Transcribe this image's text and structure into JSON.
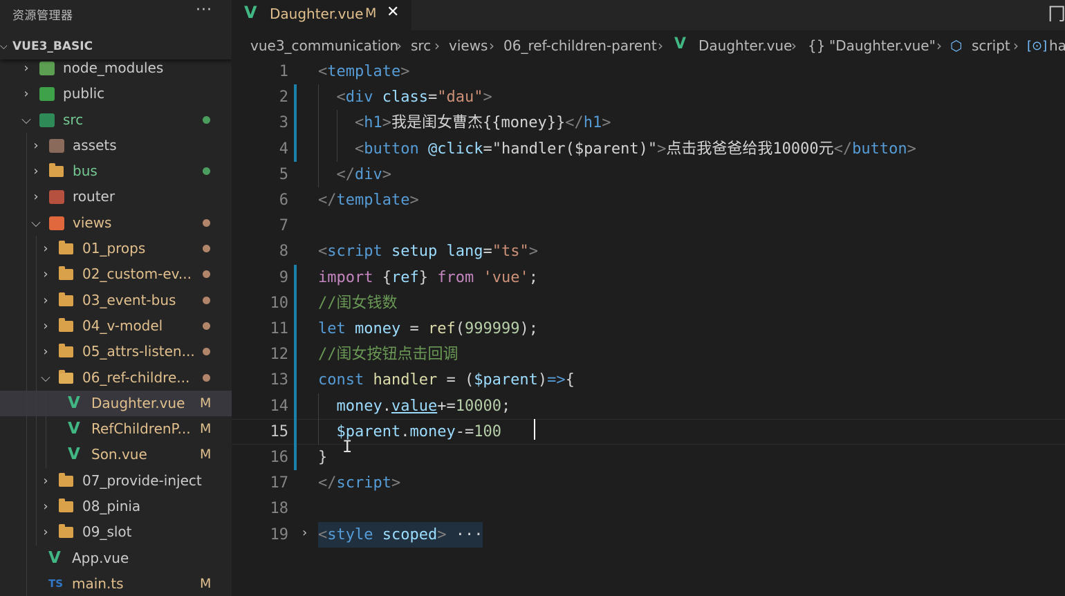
{
  "sidebar": {
    "title": "资源管理器",
    "more": "···",
    "project": "VUE3_BASIC",
    "items": [
      {
        "label": "node_modules",
        "depth": 1,
        "expanded": false,
        "icon": "node-modules-folder-icon",
        "status": ""
      },
      {
        "label": "public",
        "depth": 1,
        "expanded": false,
        "icon": "public-folder-icon",
        "status": ""
      },
      {
        "label": "src",
        "depth": 1,
        "expanded": true,
        "icon": "src-folder-icon",
        "status": "dot-green"
      },
      {
        "label": "assets",
        "depth": 2,
        "expanded": false,
        "icon": "assets-folder-icon",
        "status": ""
      },
      {
        "label": "bus",
        "depth": 2,
        "expanded": false,
        "icon": "folder-icon",
        "status": "dot-green"
      },
      {
        "label": "router",
        "depth": 2,
        "expanded": false,
        "icon": "router-folder-icon",
        "status": ""
      },
      {
        "label": "views",
        "depth": 2,
        "expanded": true,
        "icon": "views-folder-icon",
        "status": "dot-brown"
      },
      {
        "label": "01_props",
        "depth": 3,
        "expanded": false,
        "icon": "folder-icon",
        "status": "dot-brown"
      },
      {
        "label": "02_custom-ev...",
        "depth": 3,
        "expanded": false,
        "icon": "folder-icon",
        "status": "dot-brown"
      },
      {
        "label": "03_event-bus",
        "depth": 3,
        "expanded": false,
        "icon": "folder-icon",
        "status": "dot-brown"
      },
      {
        "label": "04_v-model",
        "depth": 3,
        "expanded": false,
        "icon": "folder-icon",
        "status": "dot-brown"
      },
      {
        "label": "05_attrs-listen...",
        "depth": 3,
        "expanded": false,
        "icon": "folder-icon",
        "status": "dot-brown"
      },
      {
        "label": "06_ref-childre...",
        "depth": 3,
        "expanded": true,
        "icon": "folder-open-icon",
        "status": "dot-brown"
      },
      {
        "label": "Daughter.vue",
        "depth": 4,
        "file": true,
        "icon": "vue-file-icon",
        "status": "M",
        "selected": true
      },
      {
        "label": "RefChildrenP...",
        "depth": 4,
        "file": true,
        "icon": "vue-file-icon",
        "status": "M"
      },
      {
        "label": "Son.vue",
        "depth": 4,
        "file": true,
        "icon": "vue-file-icon",
        "status": "M"
      },
      {
        "label": "07_provide-inject",
        "depth": 3,
        "expanded": false,
        "icon": "folder-icon",
        "status": ""
      },
      {
        "label": "08_pinia",
        "depth": 3,
        "expanded": false,
        "icon": "folder-icon",
        "status": ""
      },
      {
        "label": "09_slot",
        "depth": 3,
        "expanded": false,
        "icon": "folder-icon",
        "status": ""
      },
      {
        "label": "App.vue",
        "depth": 2,
        "file": true,
        "icon": "vue-file-icon",
        "status": ""
      },
      {
        "label": "main.ts",
        "depth": 2,
        "file": true,
        "icon": "ts-file-icon",
        "status": "M"
      }
    ]
  },
  "tab": {
    "title": "Daughter.vue",
    "modified": "M",
    "close": "✕"
  },
  "breadcrumb": [
    "vue3_communication",
    "src",
    "views",
    "06_ref-children-parent",
    "Daughter.vue",
    "\"Daughter.vue\"",
    "script",
    "ha"
  ],
  "colors": {
    "vue": "#41b883",
    "modified": "#e2c08d",
    "dot_green": "#4c9e5f",
    "dot_brown": "#b0856a"
  },
  "editor": {
    "current_line": 15,
    "lines": [
      [
        [
          "t-tag",
          "<"
        ],
        [
          "t-name",
          "template"
        ],
        [
          "t-tag",
          ">"
        ]
      ],
      [
        [
          "t-plain",
          "  "
        ],
        [
          "t-tag",
          "<"
        ],
        [
          "t-name",
          "div"
        ],
        [
          "t-plain",
          " "
        ],
        [
          "t-attr",
          "class"
        ],
        [
          "t-plain",
          "="
        ],
        [
          "t-str",
          "\"dau\""
        ],
        [
          "t-tag",
          ">"
        ]
      ],
      [
        [
          "t-plain",
          "    "
        ],
        [
          "t-tag",
          "<"
        ],
        [
          "t-name",
          "h1"
        ],
        [
          "t-tag",
          ">"
        ],
        [
          "t-plain",
          "我是闺女曹杰{{money}}"
        ],
        [
          "t-tag",
          "</"
        ],
        [
          "t-name",
          "h1"
        ],
        [
          "t-tag",
          ">"
        ]
      ],
      [
        [
          "t-plain",
          "    "
        ],
        [
          "t-tag",
          "<"
        ],
        [
          "t-name",
          "button"
        ],
        [
          "t-plain",
          " "
        ],
        [
          "t-attr",
          "@click"
        ],
        [
          "t-plain",
          "="
        ],
        [
          "t-plain",
          "\"handler($parent)\""
        ],
        [
          "t-tag",
          ">"
        ],
        [
          "t-plain",
          "点击我爸爸给我10000元"
        ],
        [
          "t-tag",
          "</"
        ],
        [
          "t-name",
          "button"
        ],
        [
          "t-tag",
          ">"
        ]
      ],
      [
        [
          "t-plain",
          "  "
        ],
        [
          "t-tag",
          "</"
        ],
        [
          "t-name",
          "div"
        ],
        [
          "t-tag",
          ">"
        ]
      ],
      [
        [
          "t-tag",
          "</"
        ],
        [
          "t-name",
          "template"
        ],
        [
          "t-tag",
          ">"
        ]
      ],
      [],
      [
        [
          "t-tag",
          "<"
        ],
        [
          "t-name",
          "script"
        ],
        [
          "t-plain",
          " "
        ],
        [
          "t-attr",
          "setup"
        ],
        [
          "t-plain",
          " "
        ],
        [
          "t-attr",
          "lang"
        ],
        [
          "t-plain",
          "="
        ],
        [
          "t-str",
          "\"ts\""
        ],
        [
          "t-tag",
          ">"
        ]
      ],
      [
        [
          "t-kw2",
          "import"
        ],
        [
          "t-plain",
          " {"
        ],
        [
          "t-var",
          "ref"
        ],
        [
          "t-plain",
          "} "
        ],
        [
          "t-kw2",
          "from"
        ],
        [
          "t-plain",
          " "
        ],
        [
          "t-str",
          "'vue'"
        ],
        [
          "t-plain",
          ";"
        ]
      ],
      [
        [
          "t-cmt",
          "//闺女钱数"
        ]
      ],
      [
        [
          "t-kw",
          "let"
        ],
        [
          "t-plain",
          " "
        ],
        [
          "t-var",
          "money"
        ],
        [
          "t-plain",
          " = "
        ],
        [
          "t-fn",
          "ref"
        ],
        [
          "t-plain",
          "("
        ],
        [
          "t-num",
          "999999"
        ],
        [
          "t-plain",
          ");"
        ]
      ],
      [
        [
          "t-cmt",
          "//闺女按钮点击回调"
        ]
      ],
      [
        [
          "t-kw",
          "const"
        ],
        [
          "t-plain",
          " "
        ],
        [
          "t-fn",
          "handler"
        ],
        [
          "t-plain",
          " = ("
        ],
        [
          "t-var",
          "$parent"
        ],
        [
          "t-plain",
          ")"
        ],
        [
          "t-kw",
          "=>"
        ],
        [
          "t-plain",
          "{"
        ]
      ],
      [
        [
          "t-plain",
          "  "
        ],
        [
          "t-var",
          "money"
        ],
        [
          "t-plain",
          "."
        ],
        [
          "t-var t-under",
          "value"
        ],
        [
          "t-plain",
          "+="
        ],
        [
          "t-num",
          "10000"
        ],
        [
          "t-plain",
          ";"
        ]
      ],
      [
        [
          "t-plain",
          "  "
        ],
        [
          "t-var",
          "$parent"
        ],
        [
          "t-plain",
          "."
        ],
        [
          "t-var",
          "money"
        ],
        [
          "t-plain",
          "-="
        ],
        [
          "t-num",
          "100"
        ]
      ],
      [
        [
          "t-plain",
          "}"
        ]
      ],
      [
        [
          "t-tag",
          "</"
        ],
        [
          "t-name",
          "script"
        ],
        [
          "t-tag",
          ">"
        ]
      ],
      [],
      [
        [
          "t-tag",
          "<"
        ],
        [
          "t-name",
          "style"
        ],
        [
          "t-plain",
          " "
        ],
        [
          "t-attr",
          "scoped"
        ],
        [
          "t-tag",
          ">"
        ],
        [
          "t-plain",
          " ···"
        ]
      ]
    ]
  }
}
